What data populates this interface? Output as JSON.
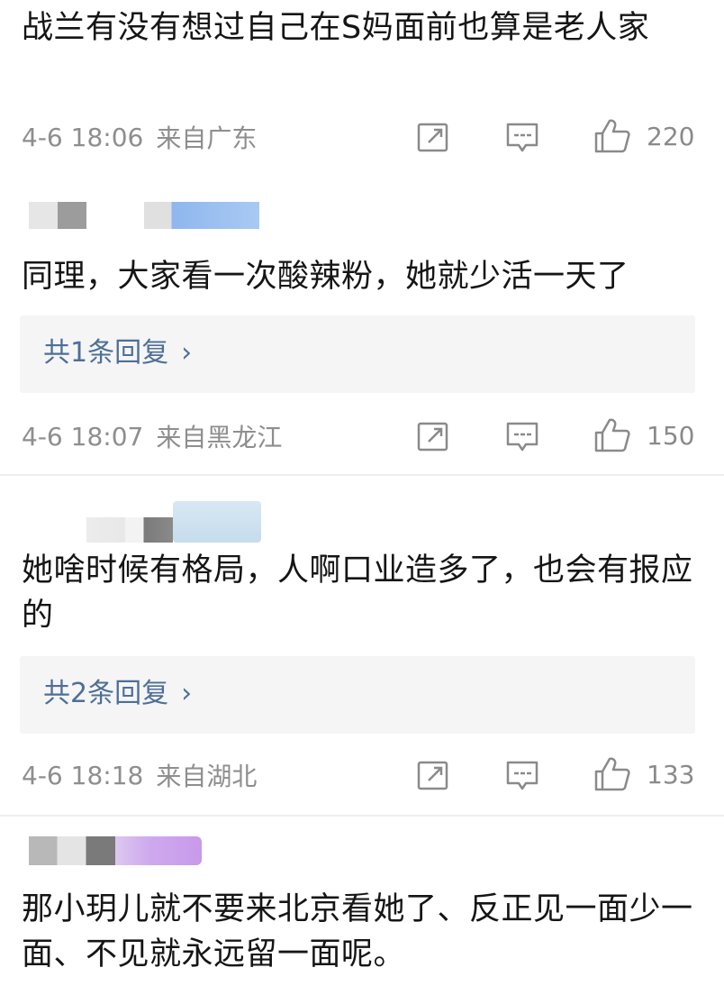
{
  "comments": [
    {
      "text": "战兰有没有想过自己在S妈面前也算是老人家",
      "time": "4-6 18:06",
      "location": "来自广东",
      "likes": "220"
    },
    {
      "text": "同理，大家看一次酸辣粉，她就少活一天了",
      "replies": "共1条回复",
      "time": "4-6 18:07",
      "location": "来自黑龙江",
      "likes": "150"
    },
    {
      "text": "她啥时候有格局，人啊口业造多了，也会有报应的",
      "replies": "共2条回复",
      "time": "4-6 18:18",
      "location": "来自湖北",
      "likes": "133"
    },
    {
      "text": "那小玥儿就不要来北京看她了、反正见一面少一面、不见就永远留一面呢。"
    }
  ],
  "icons": {
    "share": "share-icon",
    "comment": "comment-icon",
    "like": "thumbs-up-icon",
    "chevron": "chevron-right-icon"
  },
  "colors": {
    "reply_link": "#4e6f97",
    "meta": "#8e8e8e",
    "reply_bg": "#f5f5f5"
  }
}
